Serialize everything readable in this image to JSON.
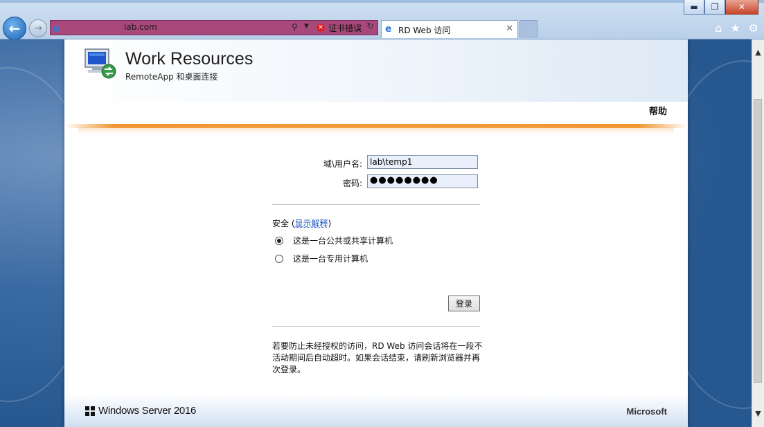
{
  "browser": {
    "address_url": "lab.com",
    "cert_error_label": "证书错误",
    "tab_title": "RD Web 访问",
    "icons": [
      "back-arrow-icon",
      "forward-arrow-icon",
      "ie-icon",
      "search-icon",
      "cert-error-icon",
      "refresh-icon",
      "close-icon",
      "home-icon",
      "favorites-star-icon",
      "gear-icon"
    ],
    "window_controls": [
      "minimize",
      "maximize",
      "close"
    ]
  },
  "header": {
    "title": "Work Resources",
    "subtitle": "RemoteApp 和桌面连接",
    "help": "帮助"
  },
  "form": {
    "username_label": "域\\用户名:",
    "username_value": "lab\\temp1",
    "password_label": "密码:",
    "password_value": "●●●●●●●●",
    "security_label": "安全",
    "security_link_open": "(",
    "security_link": "显示解释",
    "security_link_close": ")",
    "radio_public": "这是一台公共或共享计算机",
    "radio_private": "这是一台专用计算机",
    "radio_selected": "public",
    "login_button": "登录",
    "notice": "若要防止未经授权的访问，RD Web 访问会话将在一段不活动期间后自动超时。如果会话结束，请刷新浏览器并再次登录。"
  },
  "footer": {
    "product": "Windows Server 2016",
    "vendor": "Microsoft"
  },
  "colors": {
    "accent_orange": "#f39b3a",
    "address_bar_error": "#a9497b",
    "link_blue": "#1c57c2"
  }
}
